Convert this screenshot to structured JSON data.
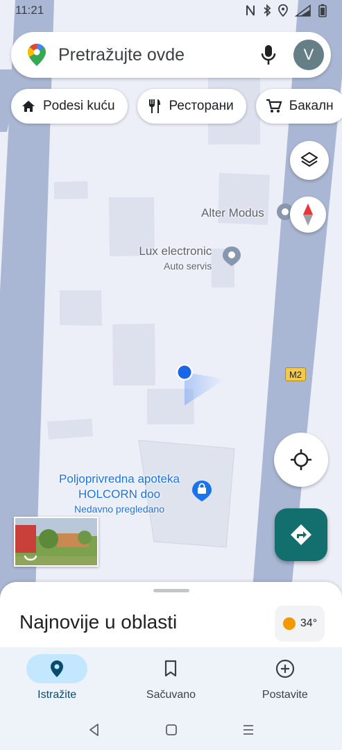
{
  "status_bar": {
    "time": "11:21"
  },
  "search": {
    "placeholder": "Pretražujte ovde",
    "avatar_letter": "V"
  },
  "chips": [
    {
      "label": "Podesi kuću",
      "icon": "home-icon"
    },
    {
      "label": "Ресторани",
      "icon": "restaurant-icon"
    },
    {
      "label": "Бакалн",
      "icon": "cart-icon"
    }
  ],
  "map": {
    "road_label": "M2",
    "places": [
      {
        "name": "Alter Modus",
        "subtitle": ""
      },
      {
        "name": "Lux electronic",
        "subtitle": "Auto servis"
      },
      {
        "name_line1": "Poljoprivredna apoteka",
        "name_line2": "HOLCORN doo",
        "subtitle": "Nedavno pregledano"
      }
    ],
    "colors": {
      "road": "#aab7d4",
      "building": "#dde1ee",
      "poi": "#1a73e8",
      "location": "#1a66e8"
    }
  },
  "sheet": {
    "title": "Najnovije u oblasti",
    "weather": "34°"
  },
  "bottom_nav": [
    {
      "label": "Istražite",
      "icon": "explore-pin-icon",
      "active": true
    },
    {
      "label": "Sačuvano",
      "icon": "bookmark-icon",
      "active": false
    },
    {
      "label": "Postavite",
      "icon": "add-circle-icon",
      "active": false
    }
  ]
}
